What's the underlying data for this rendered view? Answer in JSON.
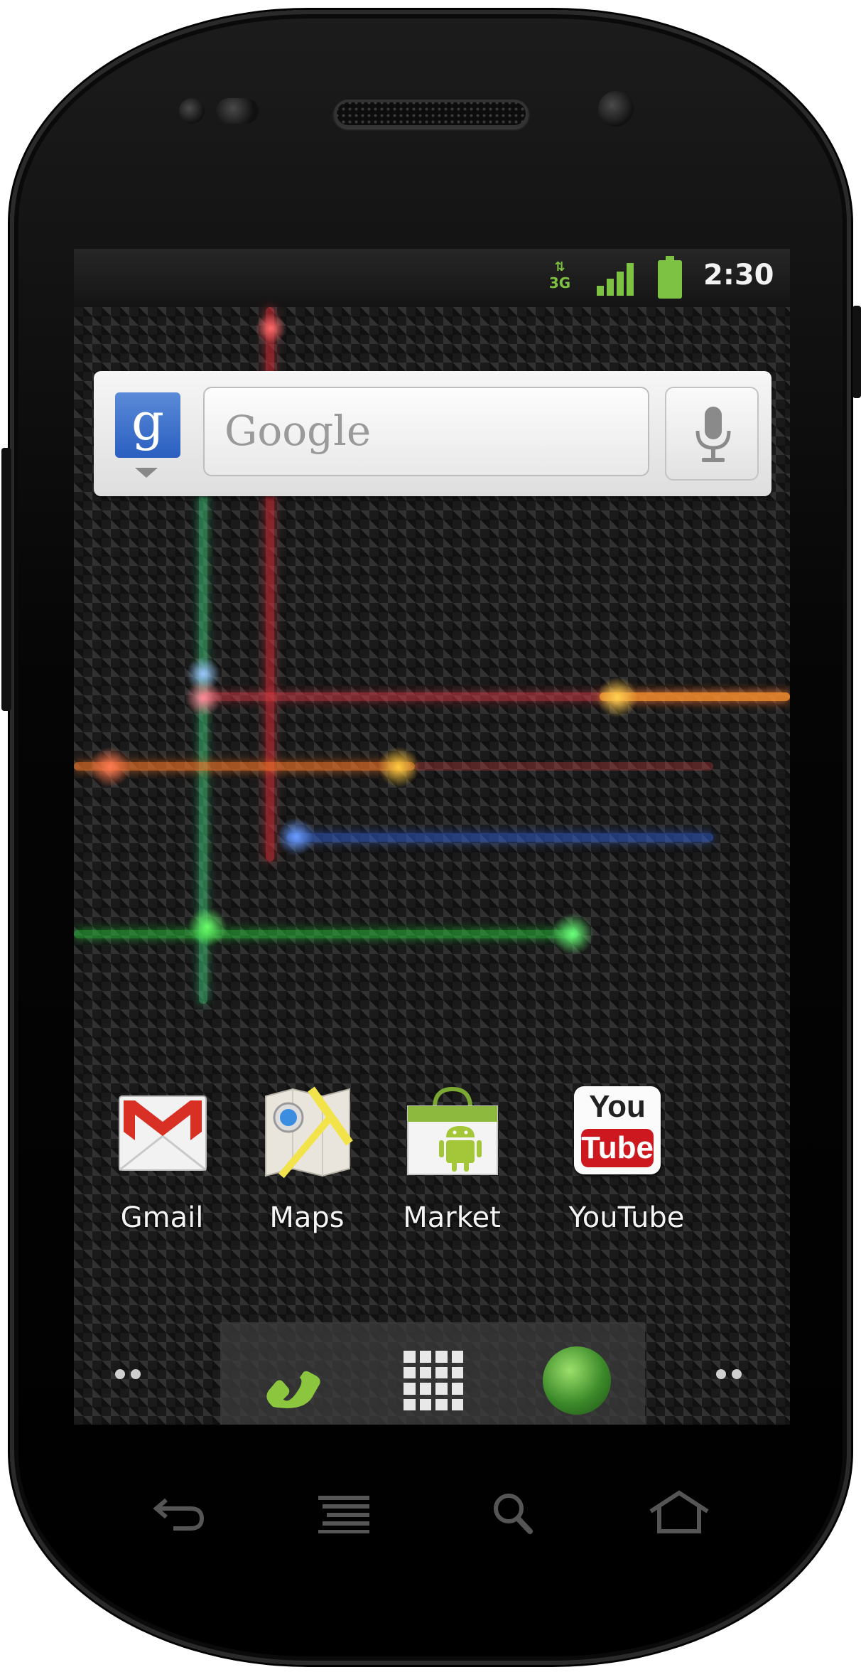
{
  "status_bar": {
    "network_type": "3G",
    "time": "2:30",
    "icons": [
      "data-activity-icon",
      "signal-strength-icon",
      "battery-icon"
    ]
  },
  "search_widget": {
    "placeholder": "Google",
    "logo_letter": "g",
    "icons": [
      "google-logo-icon",
      "microphone-icon"
    ]
  },
  "apps": [
    {
      "label": "Gmail",
      "icon": "gmail-icon"
    },
    {
      "label": "Maps",
      "icon": "maps-icon"
    },
    {
      "label": "Market",
      "icon": "market-icon"
    },
    {
      "label": "YouTube",
      "icon": "youtube-icon"
    }
  ],
  "youtube_logo": {
    "line1": "You",
    "line2": "Tube"
  },
  "dock": {
    "items": [
      "phone-icon",
      "app-drawer-icon",
      "browser-icon"
    ]
  },
  "hardware_keys": [
    "back-icon",
    "menu-icon",
    "search-icon",
    "home-icon"
  ],
  "colors": {
    "status_green": "#7dc242",
    "gmail_red": "#d93025",
    "youtube_red": "#cc181e",
    "android_green": "#a4c639"
  }
}
